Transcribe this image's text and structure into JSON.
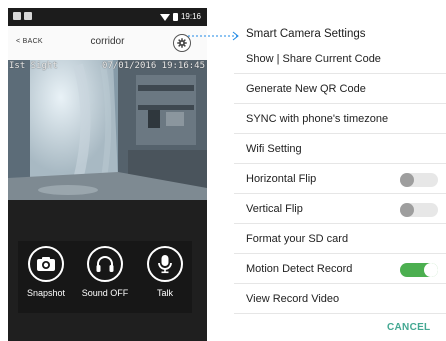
{
  "phone": {
    "time": "19:16",
    "back_label": "< BACK",
    "camera_name": "corridor",
    "overlay_left": "Ist Sight",
    "overlay_right": "07/01/2016 19:16:45",
    "controls": [
      {
        "label": "Snapshot",
        "icon": "camera-icon"
      },
      {
        "label": "Sound OFF",
        "icon": "headphones-icon"
      },
      {
        "label": "Talk",
        "icon": "microphone-icon"
      }
    ]
  },
  "menu": {
    "title": "Smart Camera Settings",
    "items": [
      {
        "label": "Show | Share Current Code"
      },
      {
        "label": "Generate New QR Code"
      },
      {
        "label": "SYNC with phone's timezone"
      },
      {
        "label": "Wifi Setting"
      },
      {
        "label": "Horizontal Flip",
        "toggle": false
      },
      {
        "label": "Vertical Flip",
        "toggle": false
      },
      {
        "label": "Format your SD card"
      },
      {
        "label": "Motion Detect Record",
        "toggle": true
      },
      {
        "label": "View Record Video"
      }
    ],
    "cancel_label": "CANCEL"
  },
  "colors": {
    "accent": "#43a892",
    "toggle_on": "#4caf50",
    "leader": "#1e88e5"
  }
}
